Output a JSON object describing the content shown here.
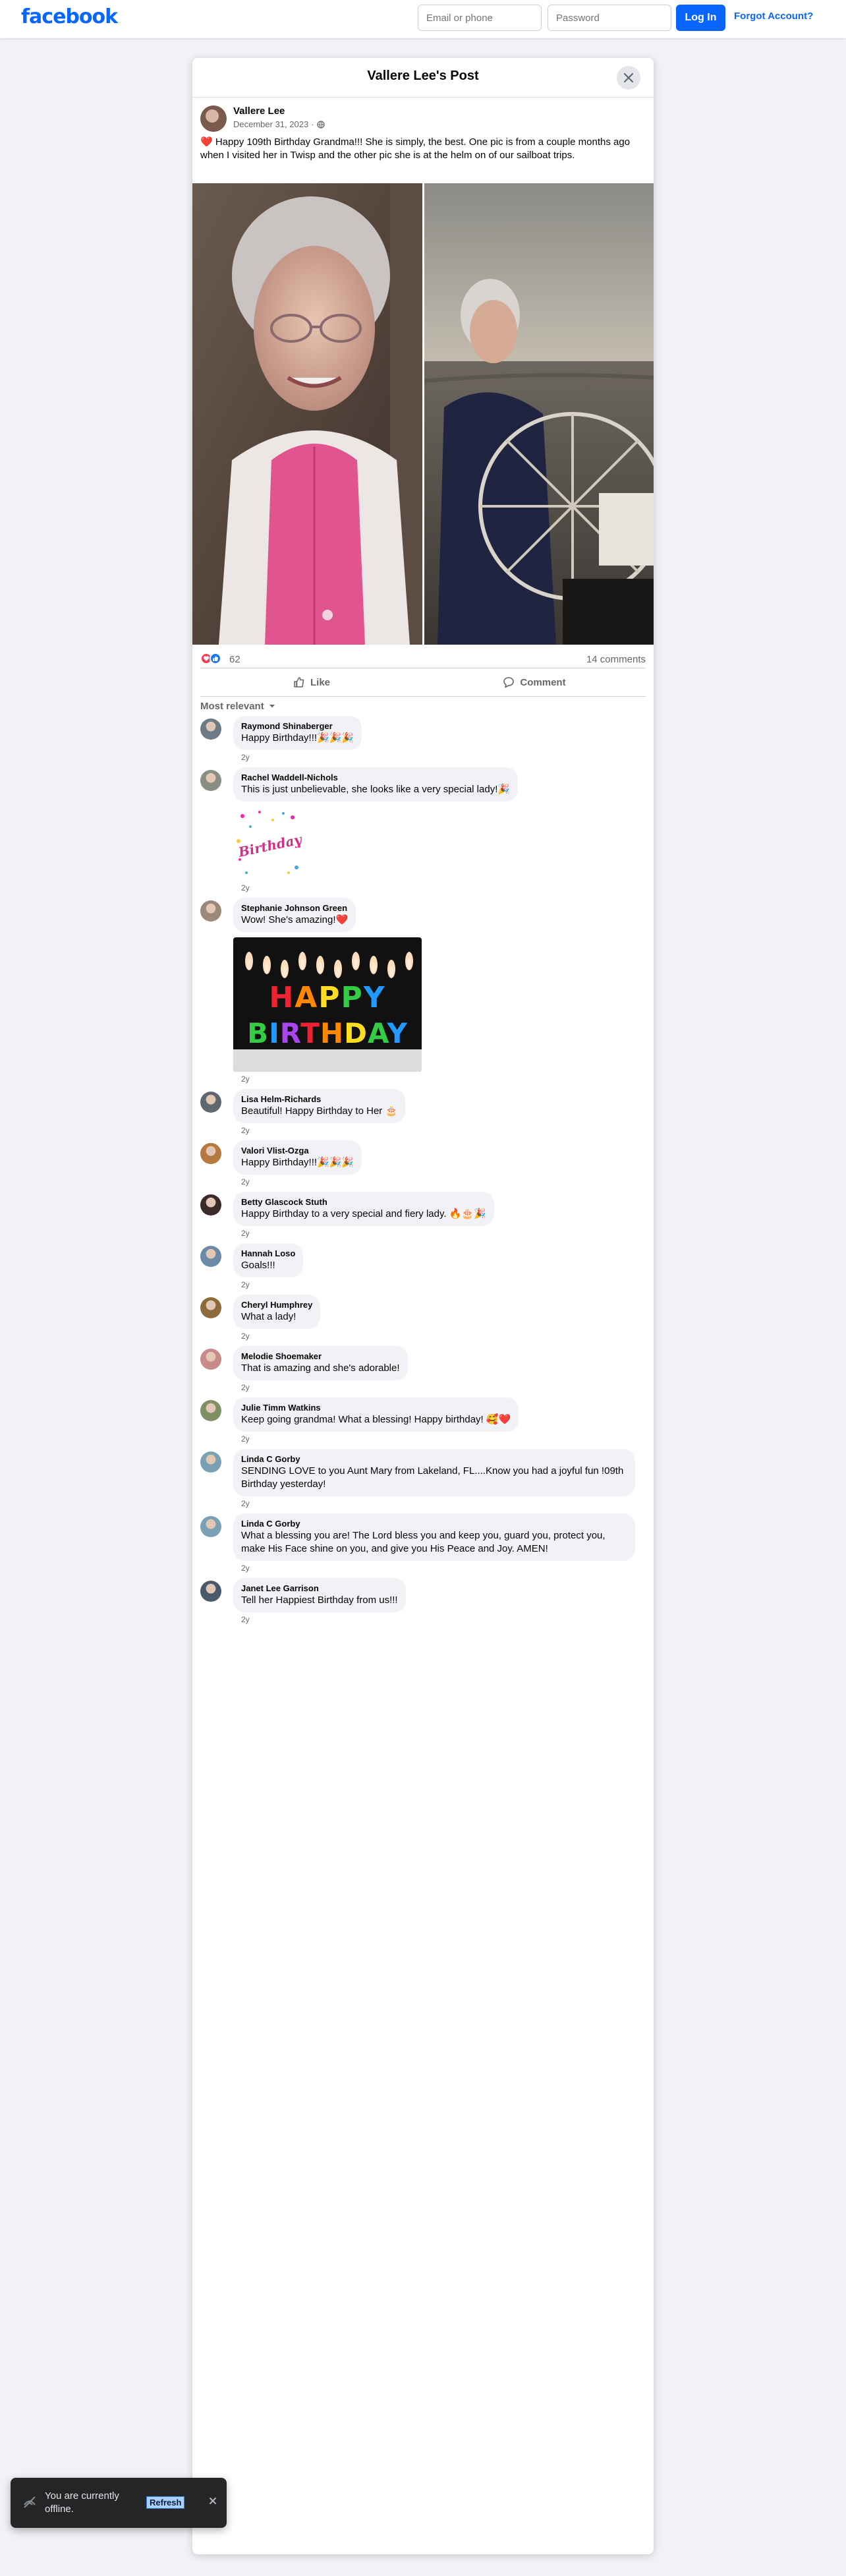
{
  "header": {
    "logo": "facebook",
    "email_placeholder": "Email or phone",
    "password_placeholder": "Password",
    "login_label": "Log In",
    "forgot_label": "Forgot Account?"
  },
  "dialog": {
    "title": "Vallere Lee's Post",
    "close_icon": "close-icon"
  },
  "post": {
    "author": "Vallere Lee",
    "date": "December 31, 2023",
    "separator": "·",
    "audience_icon": "globe-icon",
    "text": "❤️ Happy 109th Birthday Grandma!!! She is simply, the best. One pic is from a couple months ago when I visited her in Twisp and the other pic she is at the helm on of our sailboat trips."
  },
  "reactions": {
    "count": "62",
    "comments": "14 comments",
    "icons": [
      "love-reaction-icon",
      "like-reaction-icon"
    ]
  },
  "actions": {
    "like": "Like",
    "comment": "Comment"
  },
  "sort": {
    "label": "Most relevant"
  },
  "comments": [
    {
      "author": "Raymond Shinaberger",
      "text": "Happy Birthday!!!🎉🎉🎉",
      "time": "2y",
      "avatar_color": "#6d7b87"
    },
    {
      "author": "Rachel Waddell-Nichols",
      "text": "This is just unbelievable, she looks like a very special lady!🎉",
      "time": "2y",
      "avatar_color": "#8a8f86",
      "image": "sticker",
      "image_text": "Birthday"
    },
    {
      "author": "Stephanie Johnson Green",
      "text": "Wow! She's amazing!❤️",
      "time": "2y",
      "avatar_color": "#9b8878",
      "image": "candles",
      "image_text": "HAPPY BIRTHDAY"
    },
    {
      "author": "Lisa Helm-Richards",
      "text": "Beautiful! Happy Birthday to Her 🎂",
      "time": "2y",
      "avatar_color": "#5f6870"
    },
    {
      "author": "Valori Vlist-Ozga",
      "text": "Happy Birthday!!!🎉🎉🎉",
      "time": "2y",
      "avatar_color": "#b5793f"
    },
    {
      "author": "Betty Glascock Stuth",
      "text": "Happy Birthday to a very special and fiery lady. 🔥🎂🎉",
      "time": "2y",
      "avatar_color": "#3b2a2a"
    },
    {
      "author": "Hannah Loso",
      "text": "Goals!!!",
      "time": "2y",
      "avatar_color": "#6a8aa8"
    },
    {
      "author": "Cheryl Humphrey",
      "text": "What a lady!",
      "time": "2y",
      "avatar_color": "#8d6a3c"
    },
    {
      "author": "Melodie Shoemaker",
      "text": "That is amazing and she's adorable!",
      "time": "2y",
      "avatar_color": "#c98a8a"
    },
    {
      "author": "Julie Timm Watkins",
      "text": "Keep going grandma! What a blessing! Happy birthday! 🥰❤️",
      "time": "2y",
      "avatar_color": "#7e9064"
    },
    {
      "author": "Linda C Gorby",
      "text": "SENDING LOVE to you Aunt Mary from Lakeland, FL....Know you had a joyful fun !09th Birthday yesterday!",
      "time": "2y",
      "avatar_color": "#7aa0b5"
    },
    {
      "author": "Linda C Gorby",
      "text": "What a blessing you are! The Lord bless you and keep you, guard you, protect you, make His Face shine on you, and give you His Peace and Joy. AMEN!",
      "time": "2y",
      "avatar_color": "#7aa0b5"
    },
    {
      "author": "Janet Lee Garrison",
      "text": "Tell her Happiest Birthday from us!!!",
      "time": "2y",
      "avatar_color": "#4b5a6a"
    }
  ],
  "toast": {
    "text": "You are currently offline.",
    "refresh_label": "Refresh",
    "icon": "offline-icon"
  }
}
